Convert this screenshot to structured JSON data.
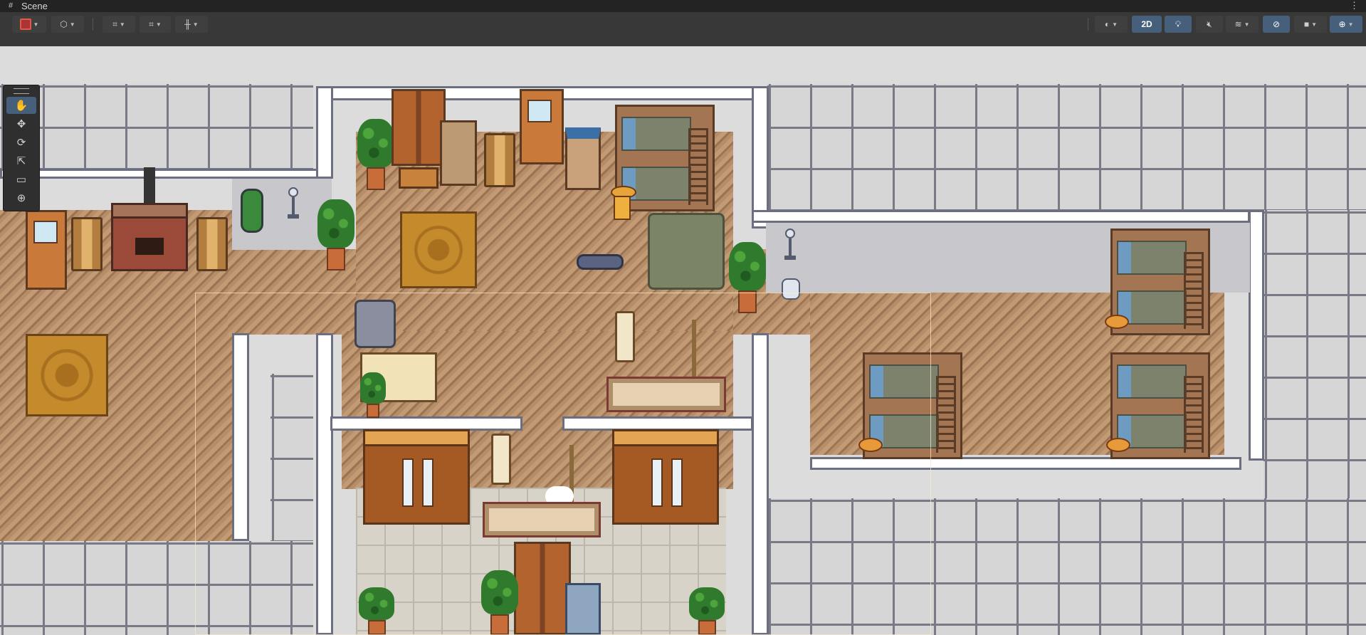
{
  "window": {
    "title": "Scene",
    "title_icon": "grid-icon",
    "menu_icon": "kebab-menu-icon"
  },
  "toolbar": {
    "left_tools": [
      {
        "name": "draw-mode-dropdown",
        "icon": "draw-mode-icon"
      },
      {
        "name": "gizmo-render-dropdown",
        "icon": "cube-icon"
      },
      {
        "name": "grid-snap-dropdown",
        "icon": "grid-snap-icon"
      },
      {
        "name": "increment-snap-dropdown",
        "icon": "increment-snap-icon"
      },
      {
        "name": "ruler-dropdown",
        "icon": "ruler-icon"
      }
    ],
    "right_tools": {
      "shading_icon": "shading-sphere-icon",
      "mode_2d_label": "2D",
      "lighting_icon": "lightbulb-icon",
      "audio_icon": "speaker-mute-icon",
      "effects_icon": "layers-icon",
      "visibility_icon": "eye-slash-icon",
      "camera_icon": "camera-icon",
      "gizmos_icon": "gizmo-globe-icon"
    },
    "accent_color": "#46607c"
  },
  "tools_panel": {
    "items": [
      {
        "name": "hand-tool",
        "icon": "hand-icon",
        "glyph": "✋",
        "active": true
      },
      {
        "name": "move-tool",
        "icon": "move-arrows-icon",
        "glyph": "✥",
        "active": false
      },
      {
        "name": "rotate-tool",
        "icon": "rotate-icon",
        "glyph": "⟳",
        "active": false
      },
      {
        "name": "scale-tool",
        "icon": "scale-icon",
        "glyph": "⇱",
        "active": false
      },
      {
        "name": "rect-tool",
        "icon": "rect-transform-icon",
        "glyph": "▭",
        "active": false
      },
      {
        "name": "transform-tool",
        "icon": "transform-icon",
        "glyph": "⊕",
        "active": false
      }
    ]
  },
  "scene": {
    "description_items": [
      "bunk-bed",
      "wardrobe",
      "plant",
      "rug",
      "fireplace",
      "door",
      "lamp",
      "character",
      "straw-hat"
    ]
  }
}
